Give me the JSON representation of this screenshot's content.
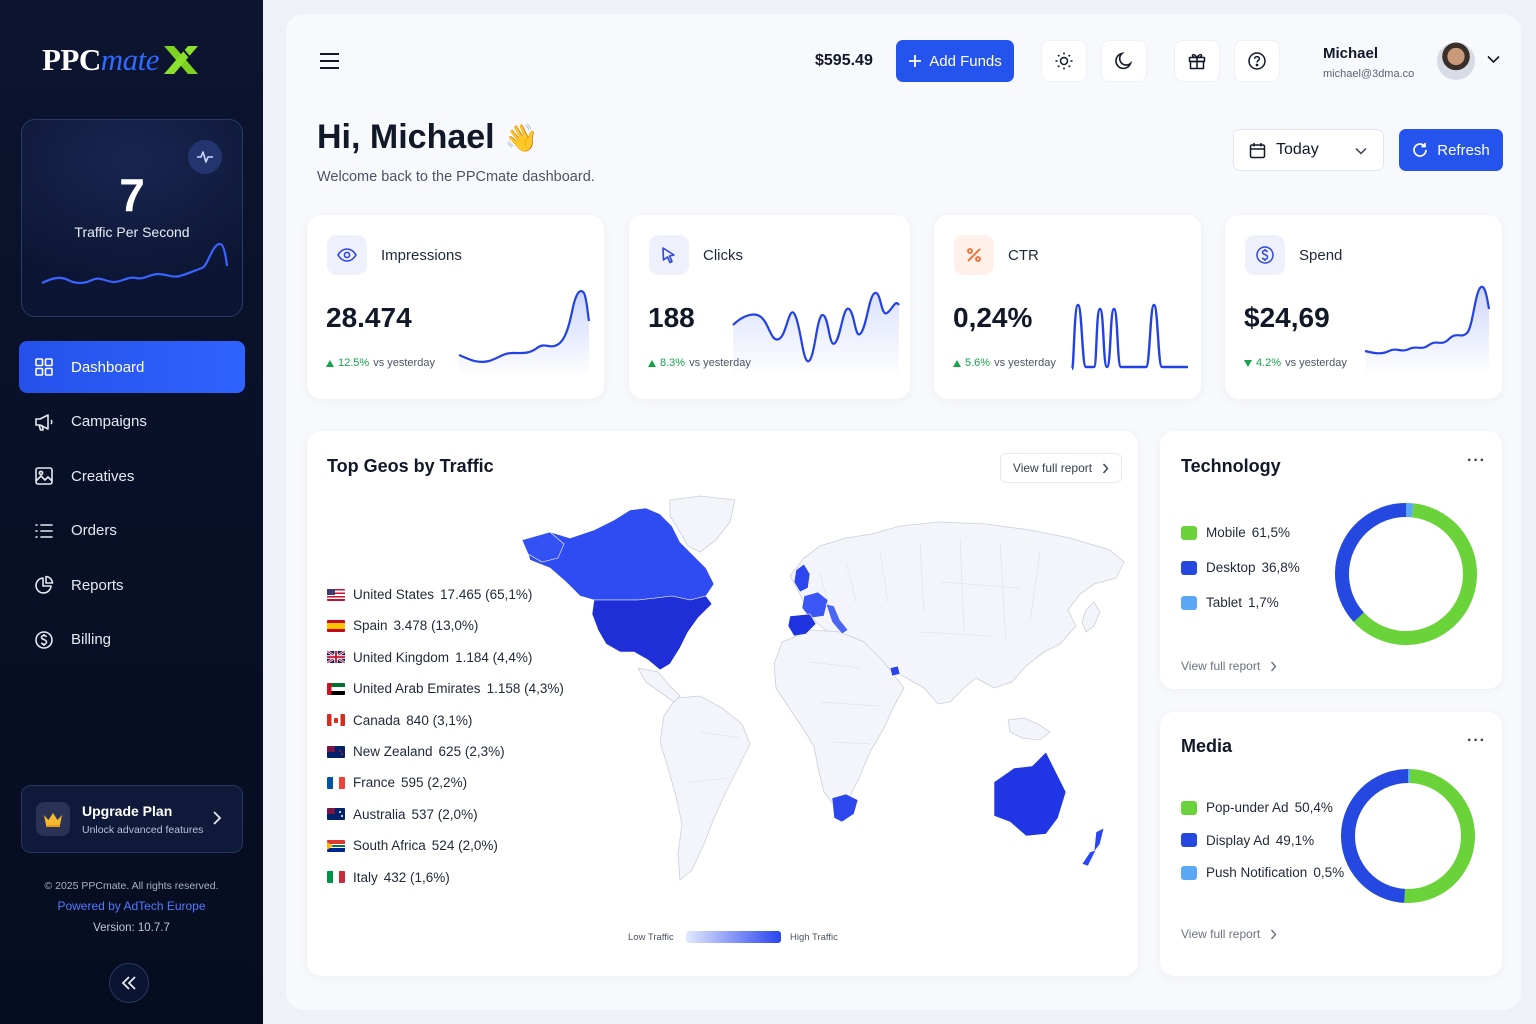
{
  "brand": {
    "part1": "PPC",
    "part2": "mate"
  },
  "traffic": {
    "value": "7",
    "label": "Traffic Per Second"
  },
  "nav": [
    {
      "label": "Dashboard",
      "icon": "grid-icon",
      "active": true
    },
    {
      "label": "Campaigns",
      "icon": "megaphone-icon"
    },
    {
      "label": "Creatives",
      "icon": "image-icon"
    },
    {
      "label": "Orders",
      "icon": "list-icon"
    },
    {
      "label": "Reports",
      "icon": "pie-chart-icon"
    },
    {
      "label": "Billing",
      "icon": "dollar-icon"
    }
  ],
  "upgrade": {
    "title": "Upgrade Plan",
    "subtitle": "Unlock advanced features"
  },
  "footer": {
    "copyright": "© 2025 PPCmate. All rights reserved.",
    "powered": "Powered by AdTech Europe",
    "version": "Version: 10.7.7"
  },
  "header": {
    "balance": "$595.49",
    "add_funds": "Add Funds",
    "user_name": "Michael",
    "user_email": "michael@3dma.co"
  },
  "greeting": {
    "title": "Hi, Michael",
    "emoji": "👋",
    "subtitle": "Welcome back to the PPCmate dashboard."
  },
  "date_filter": {
    "value": "Today"
  },
  "refresh_label": "Refresh",
  "kpis": [
    {
      "title": "Impressions",
      "value": "28.474",
      "change": "12.5%",
      "direction": "up",
      "suffix": "vs yesterday",
      "icon": "eye-icon"
    },
    {
      "title": "Clicks",
      "value": "188",
      "change": "8.3%",
      "direction": "up",
      "suffix": "vs yesterday",
      "icon": "cursor-icon"
    },
    {
      "title": "CTR",
      "value": "0,24%",
      "change": "5.6%",
      "direction": "up",
      "suffix": "vs yesterday",
      "icon": "percent-icon"
    },
    {
      "title": "Spend",
      "value": "$24,69",
      "change": "4.2%",
      "direction": "down",
      "suffix": "vs yesterday",
      "icon": "dollar-circle-icon"
    }
  ],
  "geos": {
    "title": "Top Geos by Traffic",
    "view_report": "View full report",
    "items": [
      {
        "country": "United States",
        "value": "17.465 (65,1%)",
        "flag": "us"
      },
      {
        "country": "Spain",
        "value": "3.478 (13,0%)",
        "flag": "es"
      },
      {
        "country": "United Kingdom",
        "value": "1.184 (4,4%)",
        "flag": "gb"
      },
      {
        "country": "United Arab Emirates",
        "value": "1.158 (4,3%)",
        "flag": "ae"
      },
      {
        "country": "Canada",
        "value": "840 (3,1%)",
        "flag": "ca"
      },
      {
        "country": "New Zealand",
        "value": "625 (2,3%)",
        "flag": "nz"
      },
      {
        "country": "France",
        "value": "595 (2,2%)",
        "flag": "fr"
      },
      {
        "country": "Australia",
        "value": "537 (2,0%)",
        "flag": "au"
      },
      {
        "country": "South Africa",
        "value": "524 (2,0%)",
        "flag": "za"
      },
      {
        "country": "Italy",
        "value": "432 (1,6%)",
        "flag": "it"
      }
    ],
    "legend_low": "Low Traffic",
    "legend_high": "High Traffic"
  },
  "technology": {
    "title": "Technology",
    "view_report": "View full report",
    "items": [
      {
        "label": "Mobile",
        "value": "61,5%",
        "pct": 61.5,
        "color": "#6bd33a"
      },
      {
        "label": "Desktop",
        "value": "36,8%",
        "pct": 36.8,
        "color": "#2549e0"
      },
      {
        "label": "Tablet",
        "value": "1,7%",
        "pct": 1.7,
        "color": "#5aa8f5"
      }
    ]
  },
  "media": {
    "title": "Media",
    "view_report": "View full report",
    "items": [
      {
        "label": "Pop-under Ad",
        "value": "50,4%",
        "pct": 50.4,
        "color": "#6bd33a"
      },
      {
        "label": "Display Ad",
        "value": "49,1%",
        "pct": 49.1,
        "color": "#2549e0"
      },
      {
        "label": "Push Notification",
        "value": "0,5%",
        "pct": 0.5,
        "color": "#5aa8f5"
      }
    ]
  },
  "colors": {
    "accent": "#2453ee",
    "sidebar": "#0a1230",
    "positive": "#16a34a",
    "pie_green": "#6bd33a",
    "pie_blue": "#2549e0",
    "pie_light": "#5aa8f5"
  }
}
